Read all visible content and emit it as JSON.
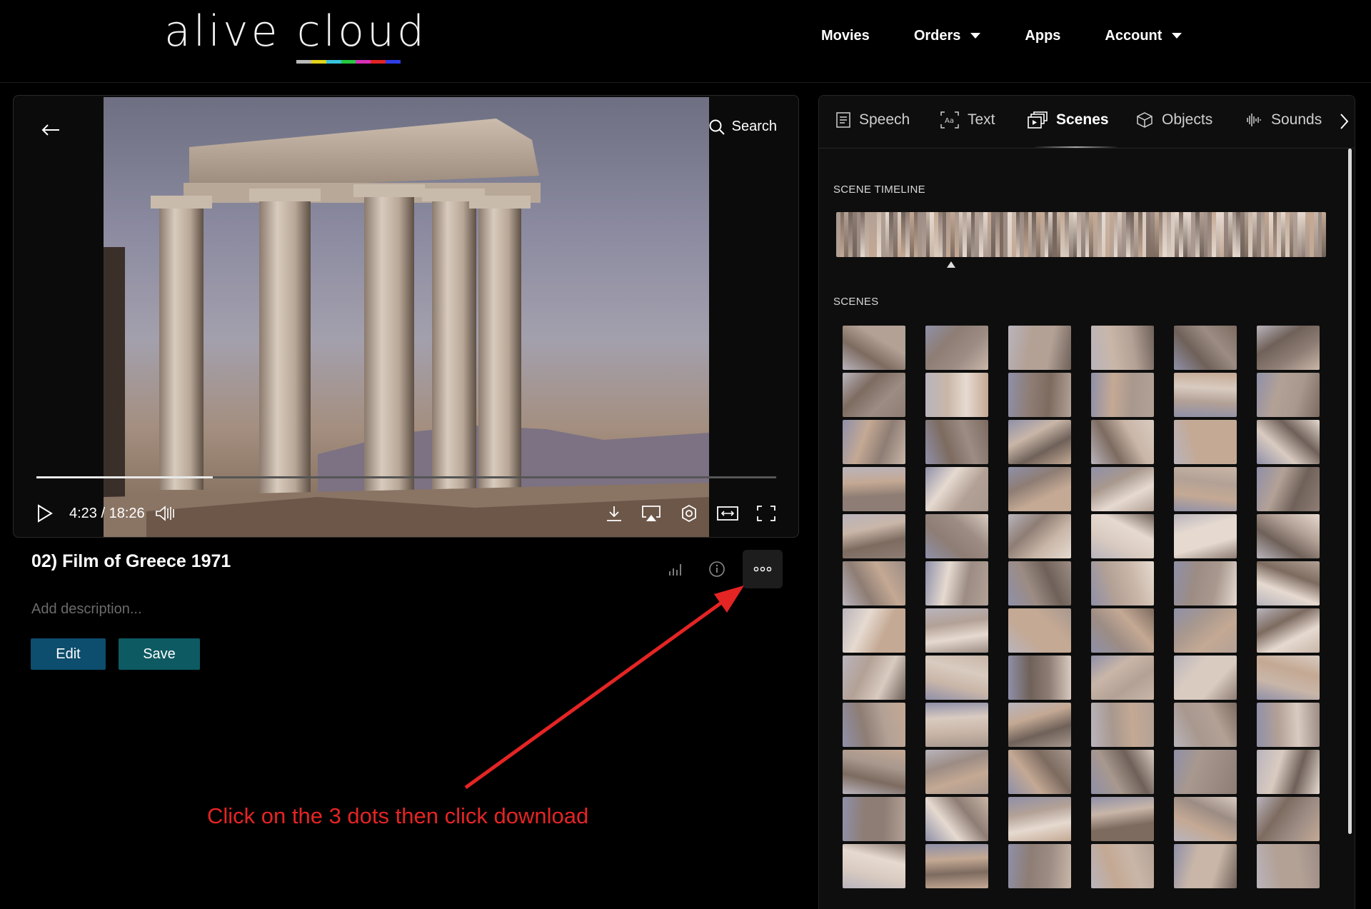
{
  "header": {
    "logo": "alive cloud",
    "logo_colors": [
      "#b9b9b9",
      "#e0d21c",
      "#38c3de",
      "#27c93f",
      "#d62fb8",
      "#e22424",
      "#2f3ee6"
    ],
    "nav": [
      {
        "label": "Movies",
        "dropdown": false
      },
      {
        "label": "Orders",
        "dropdown": true
      },
      {
        "label": "Apps",
        "dropdown": false
      },
      {
        "label": "Account",
        "dropdown": true
      }
    ]
  },
  "player": {
    "search_label": "Search",
    "current_time": "4:23",
    "duration": "18:26",
    "time_display": "4:23 / 18:26",
    "progress": 0.238
  },
  "video": {
    "title": "02) Film of Greece 1971",
    "description_placeholder": "Add description...",
    "edit_label": "Edit",
    "save_label": "Save"
  },
  "annotation": {
    "text": "Click on the 3 dots then click download",
    "color": "#e52424"
  },
  "panel": {
    "tabs": [
      {
        "label": "Speech",
        "icon": "speech-icon",
        "active": false
      },
      {
        "label": "Text",
        "icon": "text-icon",
        "active": false
      },
      {
        "label": "Scenes",
        "icon": "scenes-icon",
        "active": true
      },
      {
        "label": "Objects",
        "icon": "objects-icon",
        "active": false
      },
      {
        "label": "Sounds",
        "icon": "sounds-icon",
        "active": false
      }
    ],
    "timeline_label": "SCENE TIMELINE",
    "scenes_label": "SCENES",
    "timeline_marker": 0.235,
    "selected_scene": 33,
    "scene_count": 72
  }
}
